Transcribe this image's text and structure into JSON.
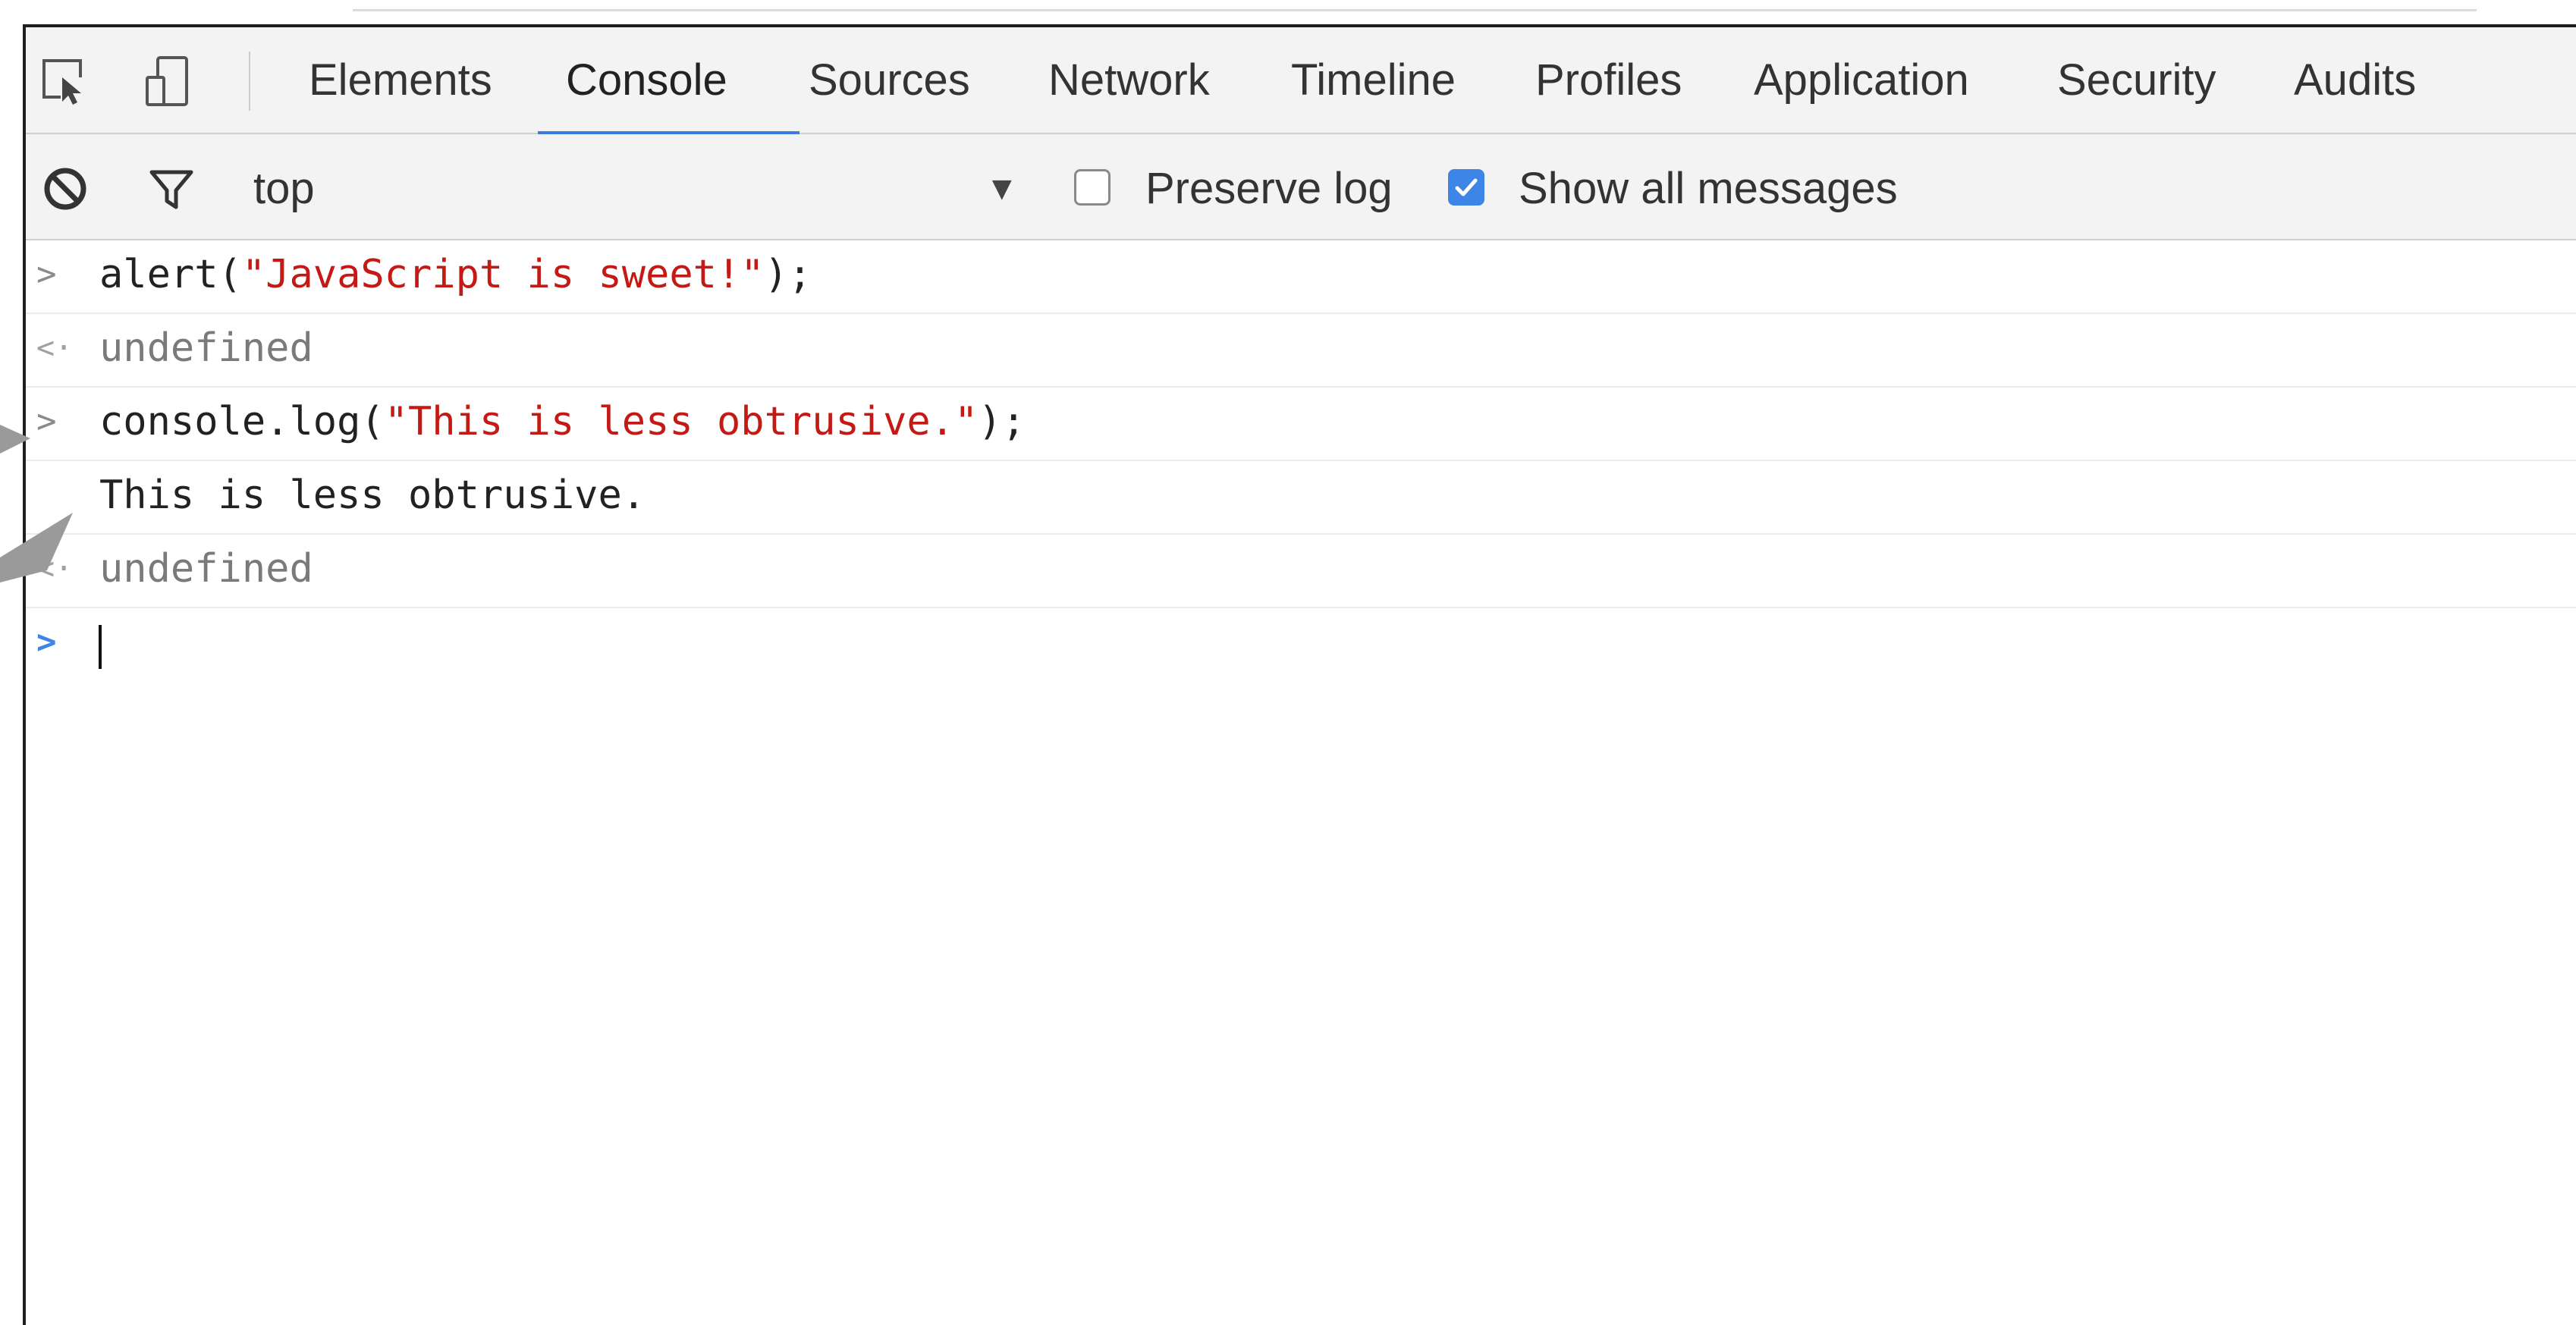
{
  "devtools": {
    "tabs": [
      {
        "label": "Elements",
        "active": false
      },
      {
        "label": "Console",
        "active": true
      },
      {
        "label": "Sources",
        "active": false
      },
      {
        "label": "Network",
        "active": false
      },
      {
        "label": "Timeline",
        "active": false
      },
      {
        "label": "Profiles",
        "active": false
      },
      {
        "label": "Application",
        "active": false
      },
      {
        "label": "Security",
        "active": false
      },
      {
        "label": "Audits",
        "active": false
      }
    ],
    "icons": {
      "inspect": "inspect-element-icon",
      "device": "device-toolbar-icon"
    }
  },
  "toolbar": {
    "clear_icon": "clear-console-icon",
    "filter_icon": "filter-icon",
    "context": "top",
    "context_arrow": "▼",
    "preserve_log": {
      "label": "Preserve log",
      "checked": false
    },
    "show_all": {
      "label": "Show all messages",
      "checked": true
    }
  },
  "console": {
    "rows": [
      {
        "type": "input",
        "gutter": ">",
        "code_pre": "alert(",
        "code_str": "\"JavaScript is sweet!\"",
        "code_post": ");"
      },
      {
        "type": "result",
        "gutter": "<·",
        "text": "undefined"
      },
      {
        "type": "input",
        "gutter": ">",
        "code_pre": "console.log(",
        "code_str": "\"This is less obtrusive.\"",
        "code_post": ");"
      },
      {
        "type": "log",
        "gutter": "",
        "text": "This is less obtrusive."
      },
      {
        "type": "result",
        "gutter": "<·",
        "text": "undefined"
      }
    ],
    "prompt": ">"
  },
  "colors": {
    "accent": "#3a7de0",
    "string": "#c41a16",
    "annotation_arrow": "#9a9a9a"
  }
}
